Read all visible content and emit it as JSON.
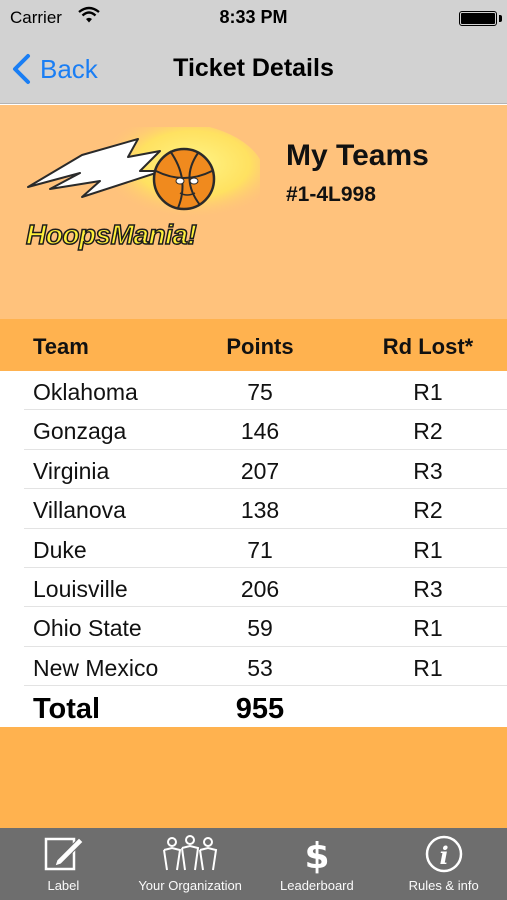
{
  "status_bar": {
    "carrier": "Carrier",
    "time": "8:33 PM"
  },
  "nav": {
    "back_label": "Back",
    "title": "Ticket Details"
  },
  "header": {
    "logo_text": "HoopsMania!",
    "ticket_title": "My Teams",
    "ticket_number": "#1-4L998",
    "colors": {
      "panel": "#ffc27c",
      "table_header": "#ffb24f"
    }
  },
  "table": {
    "columns": [
      "Team",
      "Points",
      "Rd Lost*"
    ],
    "rows": [
      {
        "team": "Oklahoma",
        "points": "75",
        "rd_lost": "R1"
      },
      {
        "team": "Gonzaga",
        "points": "146",
        "rd_lost": "R2"
      },
      {
        "team": "Virginia",
        "points": "207",
        "rd_lost": "R3"
      },
      {
        "team": "Villanova",
        "points": "138",
        "rd_lost": "R2"
      },
      {
        "team": "Duke",
        "points": "71",
        "rd_lost": "R1"
      },
      {
        "team": "Louisville",
        "points": "206",
        "rd_lost": "R3"
      },
      {
        "team": "Ohio State",
        "points": "59",
        "rd_lost": "R1"
      },
      {
        "team": "New Mexico",
        "points": "53",
        "rd_lost": "R1"
      }
    ],
    "total_label": "Total",
    "total_value": "955"
  },
  "tab_bar": {
    "items": [
      {
        "label": "Label",
        "icon": "edit-icon"
      },
      {
        "label": "Your Organization",
        "icon": "people-icon"
      },
      {
        "label": "Leaderboard",
        "icon": "dollar-icon"
      },
      {
        "label": "Rules & info",
        "icon": "info-icon"
      }
    ]
  }
}
